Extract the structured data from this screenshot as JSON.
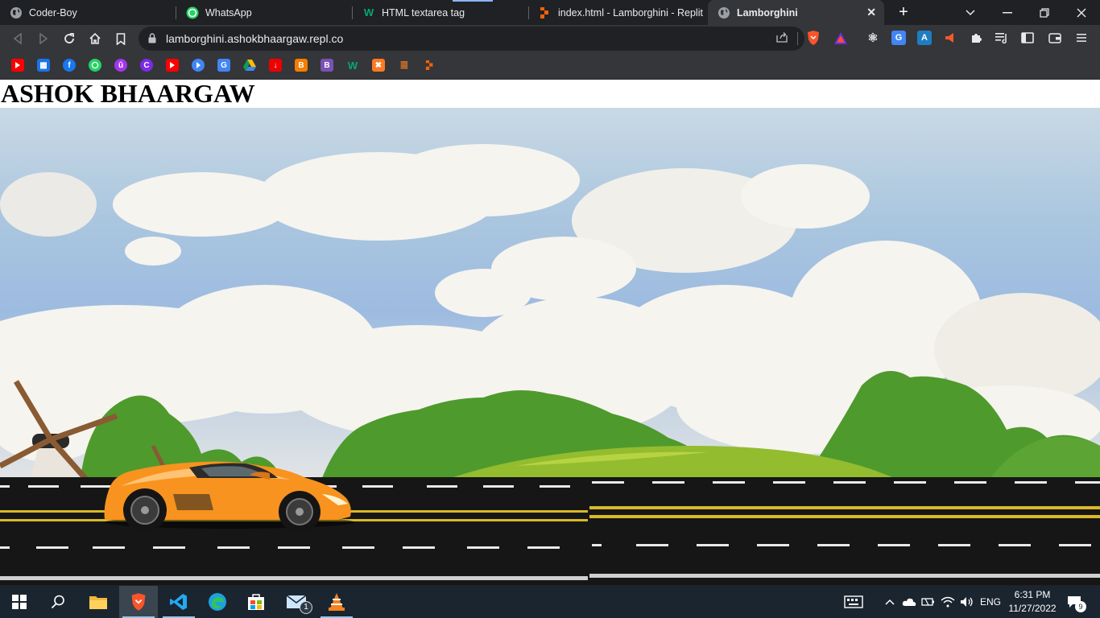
{
  "browser": {
    "tabs": [
      {
        "title": "Coder-Boy",
        "icon": "globe-icon"
      },
      {
        "title": "WhatsApp",
        "icon": "whatsapp-icon"
      },
      {
        "title": "HTML textarea tag",
        "icon": "w3schools-icon"
      },
      {
        "title": "index.html - Lamborghini - Replit",
        "icon": "replit-icon"
      },
      {
        "title": "Lamborghini",
        "icon": "globe-icon",
        "active": true
      }
    ],
    "url": "lamborghini.ashokbhaargaw.repl.co",
    "bookmarks": [
      "youtube-icon",
      "calendar-icon",
      "facebook-icon",
      "whatsapp-icon",
      "udemy-icon",
      "canva-icon",
      "youtube-icon",
      "video-icon",
      "translate-icon",
      "google-drive-icon",
      "download-icon",
      "blogger-icon",
      "bootstrap-icon",
      "w3schools-icon",
      "xampp-icon",
      "stackoverflow-icon",
      "replit-icon"
    ]
  },
  "page": {
    "heading": "ASHOK BHAARGAW",
    "scene": [
      "sky-clouds",
      "windmill",
      "trees",
      "hill",
      "road",
      "lamborghini-car"
    ]
  },
  "taskbar": {
    "apps": [
      "windows-start-icon",
      "search-icon",
      "file-explorer-icon",
      "brave-icon",
      "vscode-icon",
      "edge-icon",
      "store-icon",
      "mail-icon",
      "vlc-icon"
    ],
    "mail_badge": "1",
    "language": "ENG",
    "time": "6:31 PM",
    "date": "11/27/2022",
    "notification_count": "9"
  },
  "colors": {
    "tab_bg": "#202124",
    "toolbar_bg": "#35363a",
    "car": "#f7931e",
    "grass": "#4f9a2d",
    "road": "#181818",
    "road_yellow": "#d8b92a",
    "taskbar": "#1b2530"
  }
}
